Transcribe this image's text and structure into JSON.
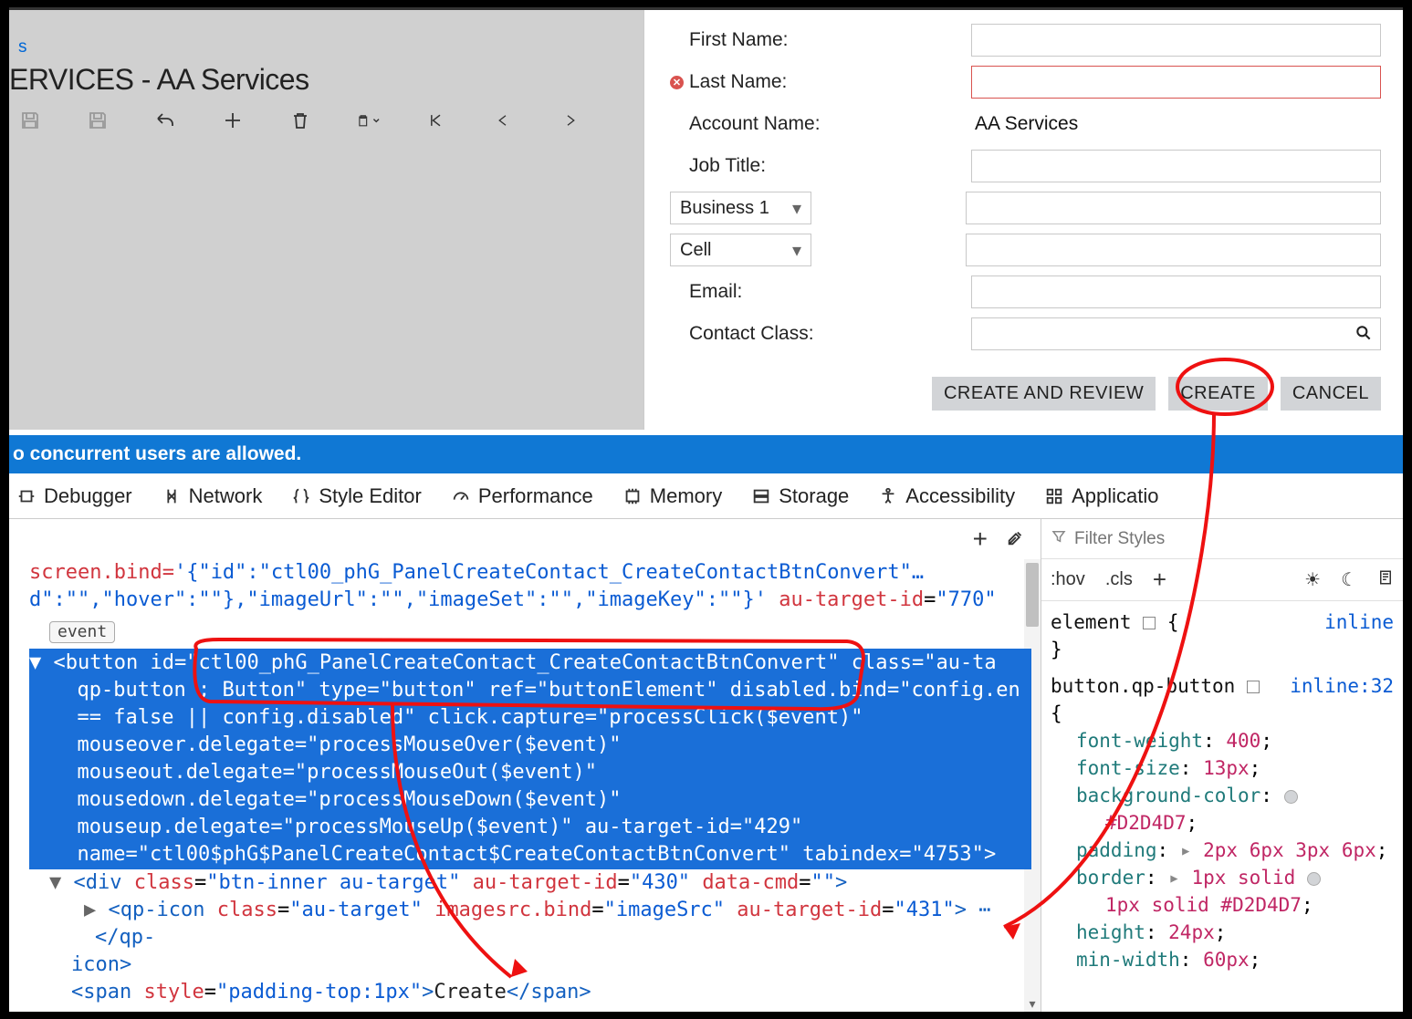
{
  "app": {
    "small_s": "s",
    "title": "ERVICES - AA Services"
  },
  "form": {
    "first_name_label": "First Name:",
    "last_name_label": "Last Name:",
    "account_name_label": "Account Name:",
    "account_name_value": "AA Services",
    "job_title_label": "Job Title:",
    "phone1_select": "Business 1",
    "phone2_select": "Cell",
    "email_label": "Email:",
    "contact_class_label": "Contact Class:"
  },
  "buttons": {
    "create_and_review": "CREATE AND REVIEW",
    "create": "CREATE",
    "cancel": "CANCEL"
  },
  "trial": {
    "text": "o concurrent users are allowed."
  },
  "devtools": {
    "tabs": {
      "debugger": "Debugger",
      "network": "Network",
      "style_editor": "Style Editor",
      "performance": "Performance",
      "memory": "Memory",
      "storage": "Storage",
      "accessibility": "Accessibility",
      "application": "Applicatio"
    },
    "filter_placeholder": "Filter Styles",
    "controls": {
      "hov": ":hov",
      "cls": ".cls"
    },
    "dom": {
      "line0_pre": "screen.bind=",
      "line0_val": "'{\"id\":\"ctl00_phG_PanelCreateContact_CreateContactBtnConvert\"…",
      "line1_pre": "d\":\"\",\"hover\":\"\"},\"imageUrl\":\"\",\"imageSet\":\"\",\"imageKey\":\"\"}'",
      "line1_attr": "au-target-id",
      "line1_val": "\"770\"",
      "event_chip": "event",
      "btn_open": "<button",
      "btn_id_attr": "id",
      "btn_id_val": "\"ctl00_phG_PanelCreateContact_CreateContactBtnConvert\"",
      "btn_class_attr": "class",
      "btn_class_val": "\"au-ta",
      "l2a": "qp-button ; Button\" ",
      "l2_type_attr": "type",
      "l2_type_val": "\"button\"",
      "l2_ref_attr": "ref",
      "l2_ref_val": "\"buttonElement\"",
      "l2_dis_attr": "disabled.bind",
      "l2_dis_val": "\"config.en",
      "l3": "== false || config.disabled\" ",
      "l3_click_attr": "click.capture",
      "l3_click_val": "\"processClick($event)\"",
      "l4_attr": "mouseover.delegate",
      "l4_val": "\"processMouseOver($event)\"",
      "l5_attr": "mouseout.delegate",
      "l5_val": "\"processMouseOut($event)\"",
      "l6_attr": "mousedown.delegate",
      "l6_val": "\"processMouseDown($event)\"",
      "l7_attr": "mouseup.delegate",
      "l7_val": "\"processMouseUp($event)\"",
      "l7b_attr": "au-target-id",
      "l7b_val": "\"429\"",
      "l8_attr": "name",
      "l8_val": "\"ctl00$phG$PanelCreateContact$CreateContactBtnConvert\"",
      "l8b_attr": "tabindex",
      "l8b_val": "\"4753\"",
      "div_open": "<div",
      "div_class_attr": "class",
      "div_class_val": "\"btn-inner au-target\"",
      "div_tid_attr": "au-target-id",
      "div_tid_val": "\"430\"",
      "div_cmd_attr": "data-cmd",
      "div_cmd_val": "\"\"",
      "qp_open": "<qp-icon",
      "qp_class_attr": "class",
      "qp_class_val": "\"au-target\"",
      "qp_img_attr": "imagesrc.bind",
      "qp_img_val": "\"imageSrc\"",
      "qp_tid_attr": "au-target-id",
      "qp_tid_val": "\"431\"",
      "qp_tail": "> ⋯ </qp-",
      "icon_close": "icon>",
      "span_open": "<span",
      "span_style_attr": "style",
      "span_style_val": "\"padding-top:1px\"",
      "span_text": "Create",
      "span_close": "</span>"
    },
    "styles": {
      "rule1_sel": "element",
      "rule1_link": "inline",
      "rule2_sel": "button.qp-button",
      "rule2_link": "inline:32",
      "p1n": "font-weight",
      "p1v": "400",
      "p2n": "font-size",
      "p2v": "13px",
      "p3n": "background-color",
      "p3v": "#D2D4D7",
      "p4n": "padding",
      "p4v": "2px 6px 3px 6px",
      "p5n": "border",
      "p5v": "1px solid #D2D4D7",
      "p6n": "height",
      "p6v": "24px",
      "p7n": "min-width",
      "p7v": "60px"
    }
  }
}
